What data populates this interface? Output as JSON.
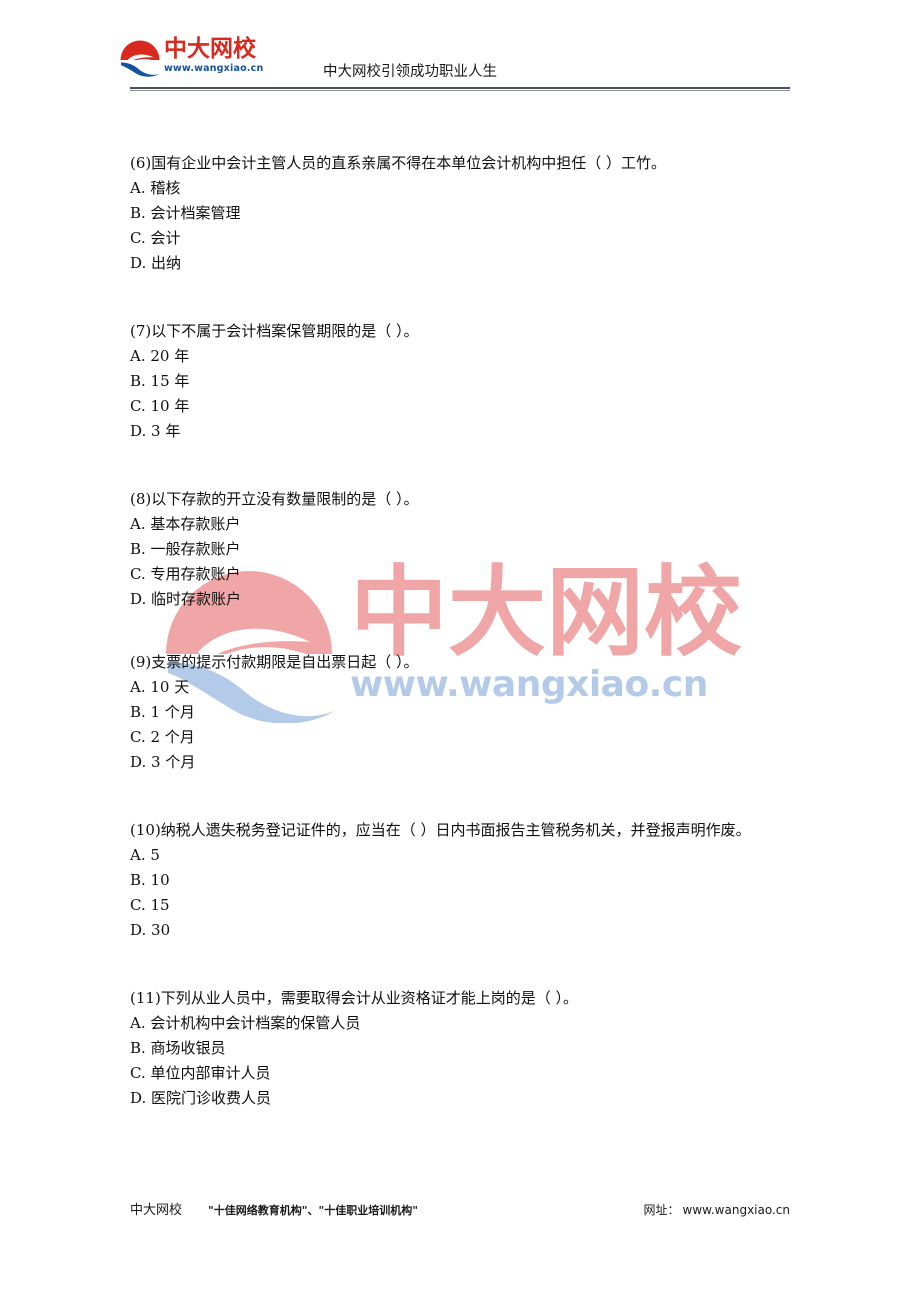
{
  "header": {
    "logo_name_cn": "中大网校",
    "logo_url": "www.wangxiao.cn",
    "slogan": "中大网校引领成功职业人生"
  },
  "watermark": {
    "name_cn": "中大网校",
    "url": "www.wangxiao.cn",
    "red": "#f0a6a6",
    "blue": "#b3cbe8"
  },
  "questions": [
    {
      "stem": "(6)国有企业中会计主管人员的直系亲属不得在本单位会计机构中担任（    ）工竹。",
      "options": [
        "A. 稽核",
        "B. 会计档案管理",
        "C. 会计",
        "D. 出纳"
      ]
    },
    {
      "stem": "(7)以下不属于会计档案保管期限的是（    ）。",
      "options": [
        "A. 20 年",
        "B. 15 年",
        "C. 10 年",
        "D. 3 年"
      ]
    },
    {
      "stem": "(8)以下存款的开立没有数量限制的是（    ）。",
      "options": [
        "A. 基本存款账户",
        "B. 一般存款账户",
        "C. 专用存款账户",
        "D. 临时存款账户"
      ]
    },
    {
      "stem": "(9)支票的提示付款期限是自出票日起（    ）。",
      "options": [
        "A. 10 天",
        "B. 1 个月",
        "C. 2 个月",
        "D. 3 个月"
      ]
    },
    {
      "stem": "(10)纳税人遗失税务登记证件的，应当在（    ）日内书面报告主管税务机关，并登报声明作废。",
      "options": [
        "A. 5",
        "B. 10",
        "C. 15",
        "D. 30"
      ]
    },
    {
      "stem": "(11)下列从业人员中，需要取得会计从业资格证才能上岗的是（    ）。",
      "options": [
        "A. 会计机构中会计档案的保管人员",
        "B. 商场收银员",
        "C. 单位内部审计人员",
        "D. 医院门诊收费人员"
      ]
    }
  ],
  "footer": {
    "brand": "中大网校",
    "awards": "\"十佳网络教育机构\"、\"十佳职业培训机构\"",
    "site_label": "网址：",
    "site_url": "www.wangxiao.cn"
  },
  "colors": {
    "logo_red": "#d7291e",
    "logo_blue": "#14539f",
    "rule": "#4f4f63",
    "text": "#101010"
  }
}
